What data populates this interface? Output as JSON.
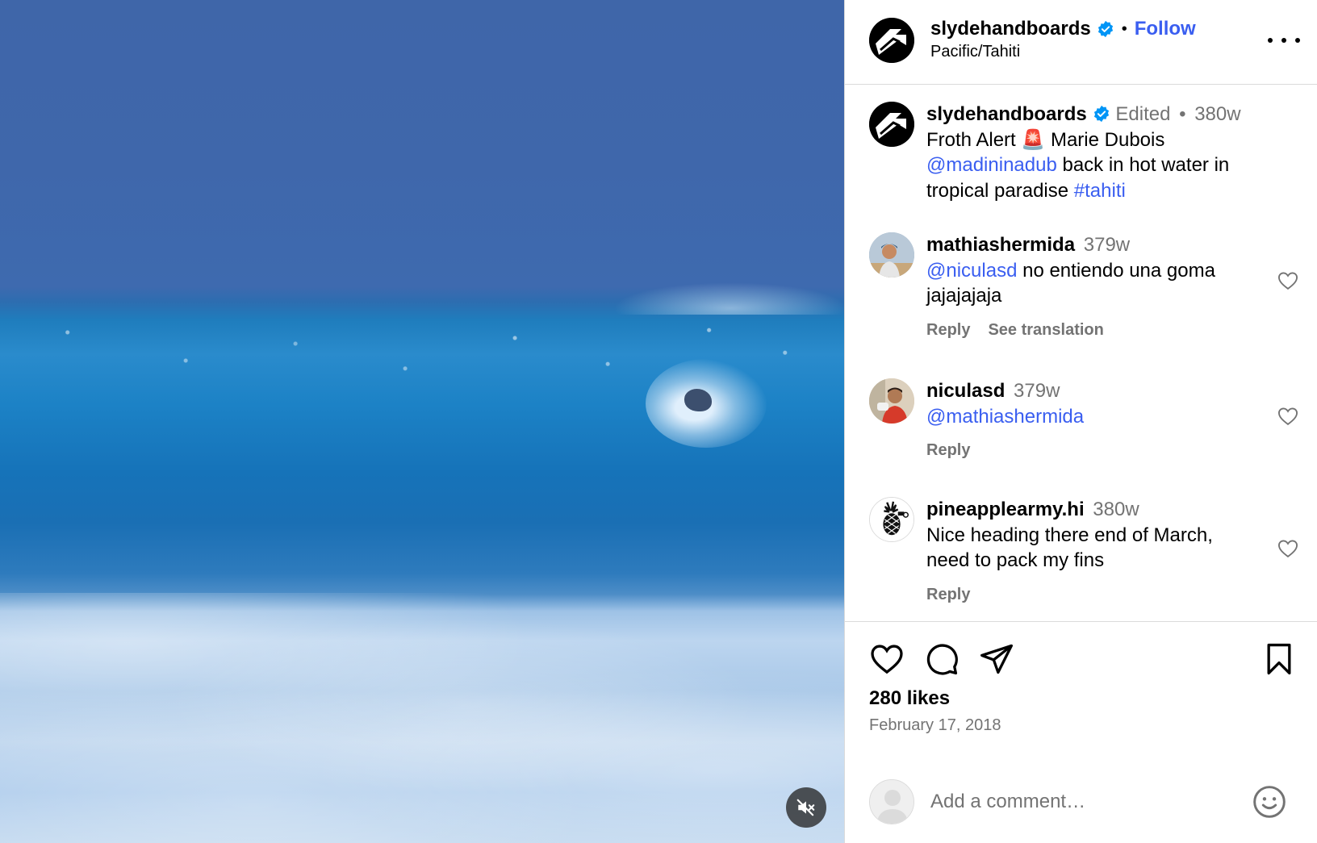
{
  "media": {
    "type": "video",
    "mute_icon": "speaker-muted-icon"
  },
  "header": {
    "username": "slydehandboards",
    "verified_icon": "verified-badge-icon",
    "separator": "•",
    "follow_label": "Follow",
    "location": "Pacific/Tahiti",
    "more_icon": "more-horizontal-icon"
  },
  "caption": {
    "username": "slydehandboards",
    "edited": "Edited",
    "separator": "•",
    "age": "380w",
    "text_1": "Froth Alert",
    "emoji": "🚨",
    "text_2": "Marie Dubois",
    "mention": "@madininadub",
    "text_3": "back in hot water in tropical paradise",
    "hashtag": "#tahiti"
  },
  "comments": [
    {
      "username": "mathiashermida",
      "age": "379w",
      "mention": "@niculasd",
      "text": "no entiendo una goma jajajajaja",
      "reply_label": "Reply",
      "translate_label": "See translation"
    },
    {
      "username": "niculasd",
      "age": "379w",
      "mention": "@mathiashermida",
      "text": "",
      "reply_label": "Reply"
    },
    {
      "username": "pineapplearmy.hi",
      "age": "380w",
      "mention": "",
      "text": "Nice heading there end of March, need to pack my fins",
      "reply_label": "Reply"
    }
  ],
  "actions": {
    "like_icon": "heart-icon",
    "comment_icon": "comment-bubble-icon",
    "share_icon": "paper-plane-icon",
    "save_icon": "bookmark-icon"
  },
  "likes_text": "280 likes",
  "date": "February 17, 2018",
  "comment_box": {
    "placeholder": "Add a comment…",
    "emoji_icon": "smiley-icon"
  },
  "colors": {
    "link_blue": "#3a5ef0",
    "verified_blue": "#0095f6",
    "secondary_text": "#737373",
    "divider": "#dbdbdb"
  }
}
